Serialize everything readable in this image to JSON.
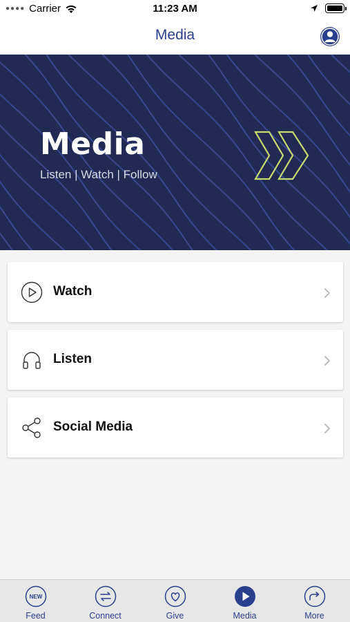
{
  "status_bar": {
    "carrier": "Carrier",
    "time": "11:23 AM"
  },
  "nav": {
    "title": "Media",
    "profile_icon": "person-circle-icon"
  },
  "hero": {
    "title": "Media",
    "subtitle": "Listen | Watch | Follow",
    "background_color": "#202a52",
    "accent_color": "#c8dc6e"
  },
  "menu": {
    "items": [
      {
        "label": "Watch",
        "icon": "play-circle-icon"
      },
      {
        "label": "Listen",
        "icon": "headphones-icon"
      },
      {
        "label": "Social Media",
        "icon": "share-icon"
      }
    ]
  },
  "tab_bar": {
    "active_color": "#2a3f8e",
    "tabs": [
      {
        "label": "Feed",
        "icon": "new-badge-icon",
        "active": false
      },
      {
        "label": "Connect",
        "icon": "arrows-exchange-icon",
        "active": false
      },
      {
        "label": "Give",
        "icon": "heart-icon",
        "active": false
      },
      {
        "label": "Media",
        "icon": "play-filled-icon",
        "active": true
      },
      {
        "label": "More",
        "icon": "forward-arrow-icon",
        "active": false
      }
    ],
    "feed_badge_text": "NEW"
  }
}
